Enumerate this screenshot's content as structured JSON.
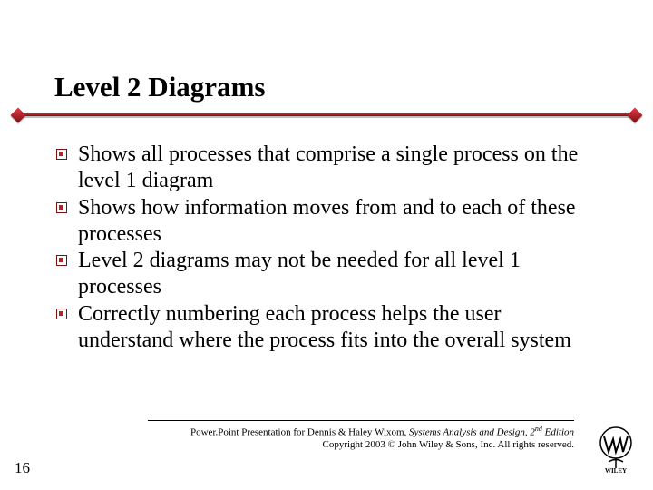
{
  "title": "Level 2 Diagrams",
  "bullets": [
    "Shows all processes that comprise a single process on the level 1 diagram",
    "Shows how information moves from and to each of these processes",
    "Level 2 diagrams may not be needed for all level 1 processes",
    "Correctly numbering each process helps the user understand where the process fits into the overall system"
  ],
  "footer": {
    "line1_pre": "Power.Point Presentation for Dennis & Haley Wixom, ",
    "line1_title": "Systems Analysis and Design, ",
    "edition_num": "2",
    "edition_suffix": "nd",
    "edition_word": " Edition",
    "line2": "Copyright 2003 © John Wiley & Sons, Inc.  All rights reserved."
  },
  "page_number": "16"
}
